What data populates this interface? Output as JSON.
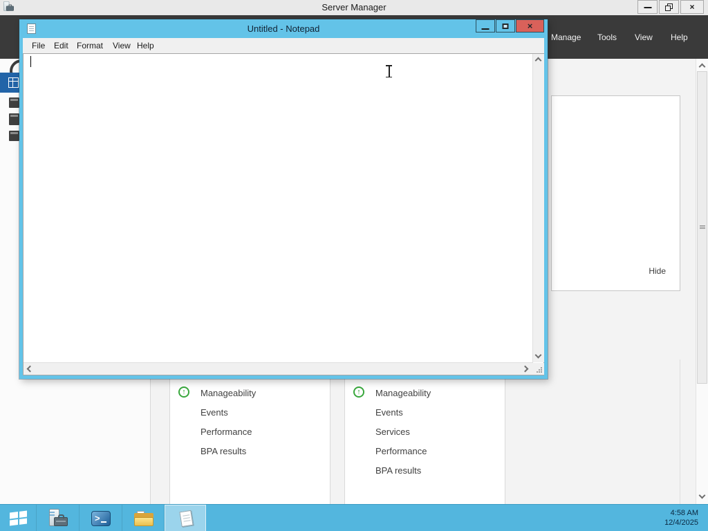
{
  "server_manager": {
    "title": "Server Manager",
    "menu": {
      "manage": "Manage",
      "tools": "Tools",
      "view": "View",
      "help": "Help"
    },
    "welcome_panel": {
      "hide_label": "Hide"
    },
    "dashboard_tiles": [
      {
        "rows": [
          "Manageability",
          "Events",
          "Performance",
          "BPA results"
        ]
      },
      {
        "rows": [
          "Manageability",
          "Events",
          "Services",
          "Performance",
          "BPA results"
        ]
      }
    ]
  },
  "notepad": {
    "title": "Untitled - Notepad",
    "menu": {
      "file": "File",
      "edit": "Edit",
      "format": "Format",
      "view": "View",
      "help": "Help"
    },
    "content": ""
  },
  "taskbar": {
    "clock": {
      "time": "4:58 AM",
      "date": "12/4/2025"
    }
  },
  "icons": {
    "close": "×",
    "up_arrow": "↑"
  },
  "colors": {
    "taskbar_blue": "#53b6de",
    "notepad_titlebar_blue": "#63c3e8",
    "close_button_red": "#d9615a",
    "sidebar_selection_blue": "#2264a8",
    "status_green": "#38a73c",
    "dark_header": "#3a3a3a"
  }
}
